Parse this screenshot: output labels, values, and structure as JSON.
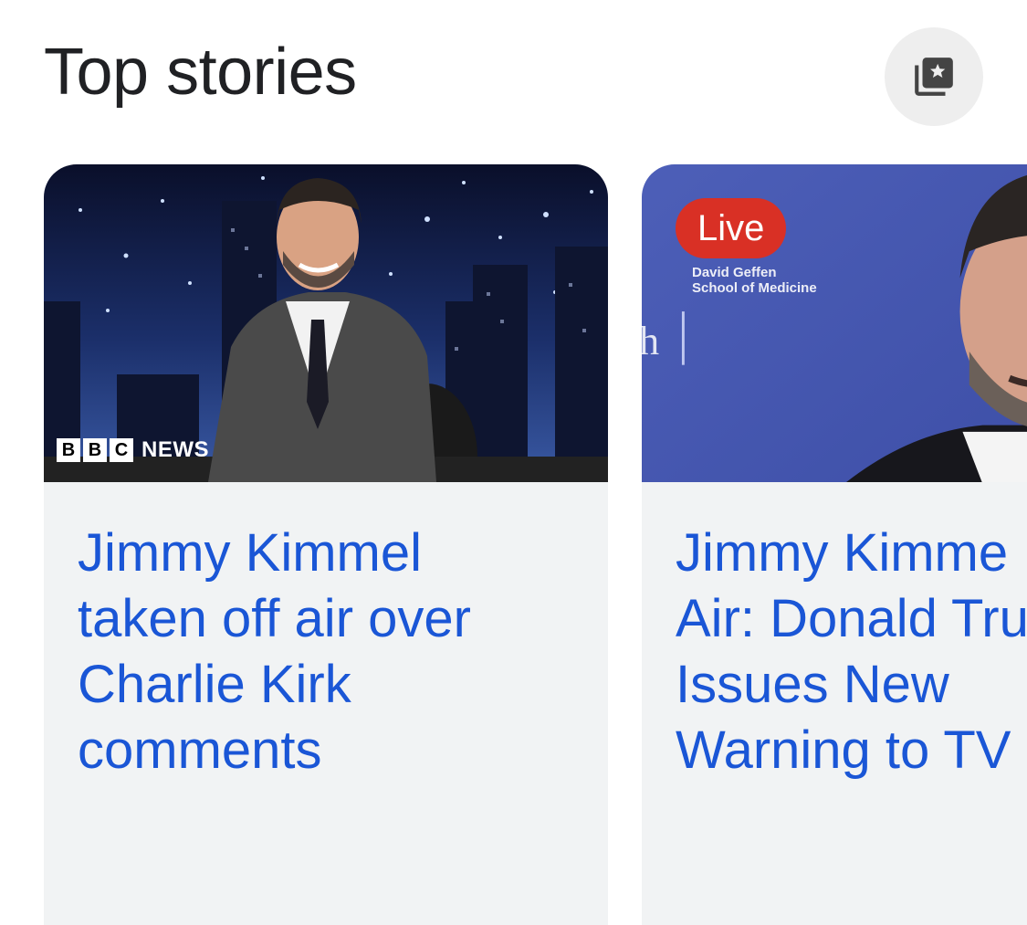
{
  "section": {
    "title": "Top stories",
    "collection_icon": "collection-star-icon"
  },
  "stories": [
    {
      "headline": "Jimmy Kimmel\ntaken off air over\nCharlie Kirk\ncomments",
      "source_logo": {
        "blocks": [
          "B",
          "B",
          "C"
        ],
        "text": "NEWS"
      }
    },
    {
      "headline": "Jimmy Kimme\nAir: Donald Tru\nIssues New\nWarning to TV",
      "badge": "Live",
      "backdrop_text": {
        "line1": "David Geffen",
        "line2": "School of Medicine"
      }
    }
  ],
  "colors": {
    "headline": "#1a56d6",
    "card_bg": "#f1f3f4",
    "live_badge": "#d93025",
    "button_bg": "#eeeeee"
  }
}
